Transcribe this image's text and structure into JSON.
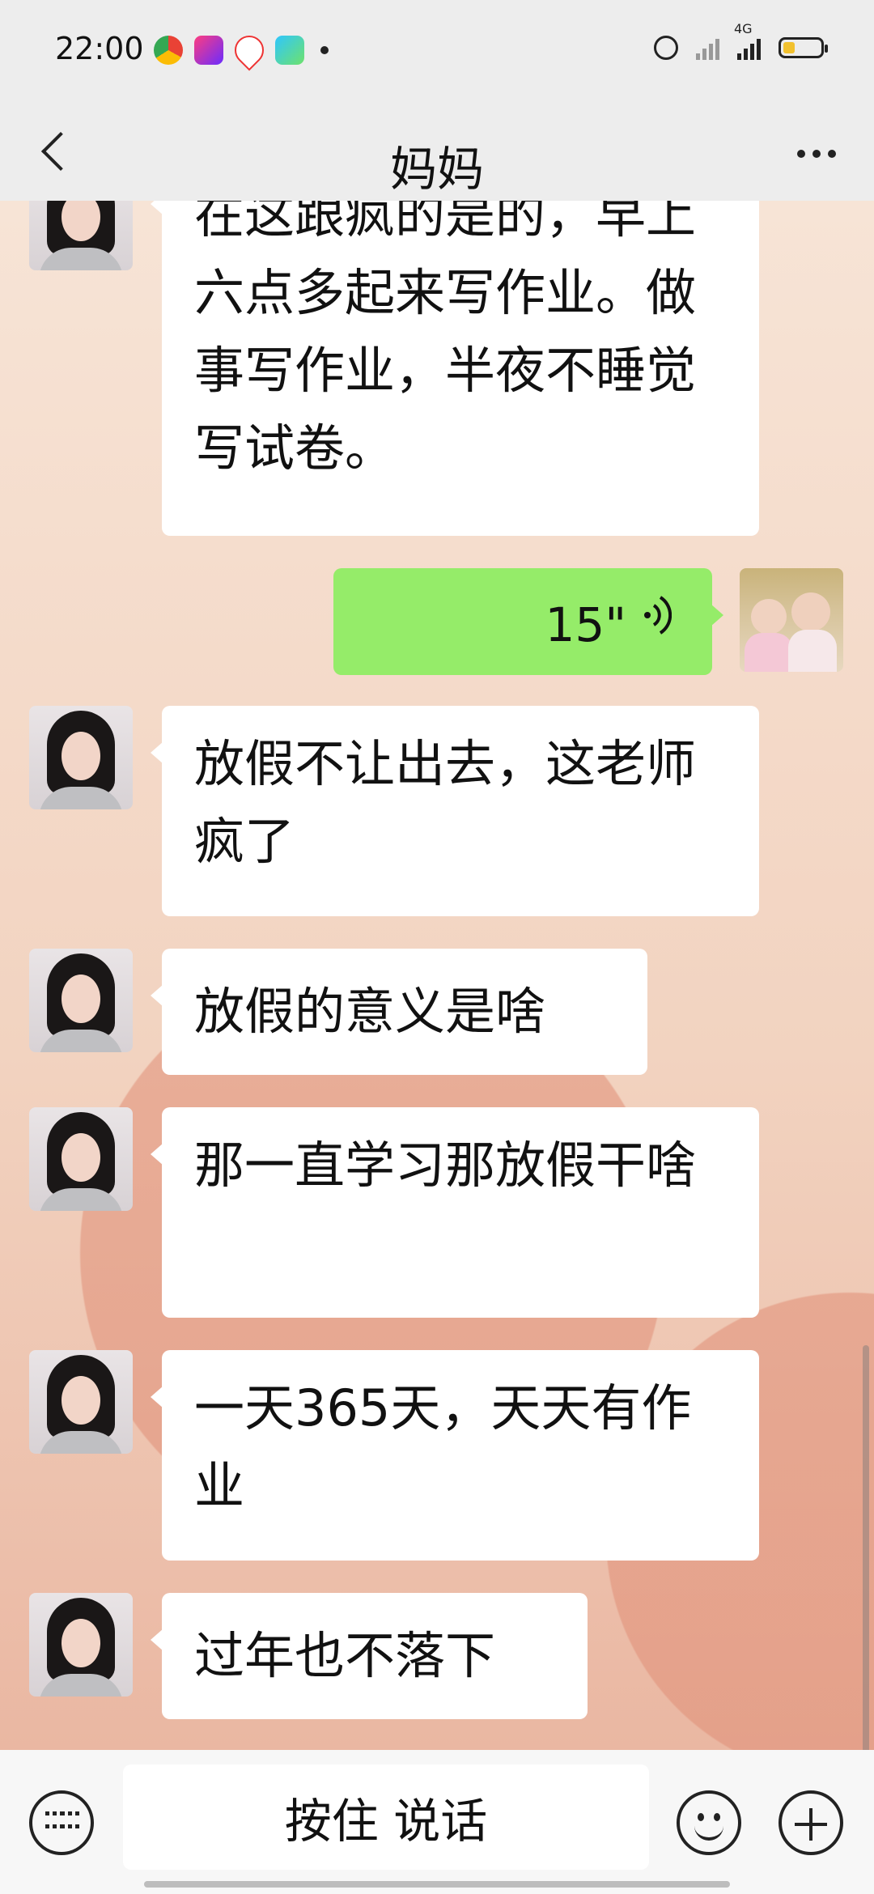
{
  "status_bar": {
    "time": "22:00",
    "network": "4G",
    "app_icons": [
      "chrome-like-app-icon",
      "video-app-icon",
      "map-pin-app-icon",
      "tencent-video-icon"
    ],
    "battery_color": "#f2c12e"
  },
  "header": {
    "title": "妈妈",
    "back_icon": "chevron-left-icon",
    "more_icon": "ellipsis-icon"
  },
  "messages": [
    {
      "side": "left",
      "text": "在这跟疯的是的，早上六点多起来写作业。做事写作业，半夜不睡觉写试卷。"
    },
    {
      "side": "right",
      "type": "voice",
      "duration": "15\""
    },
    {
      "side": "left",
      "text": "放假不让出去，这老师疯了"
    },
    {
      "side": "left",
      "text": "放假的意义是啥"
    },
    {
      "side": "left",
      "text": "那一直学习那放假干啥"
    },
    {
      "side": "left",
      "text": "一天365天，天天有作业"
    },
    {
      "side": "left",
      "text": "过年也不落下"
    }
  ],
  "bottom_bar": {
    "hold_to_talk": "按住 说话",
    "keyboard_icon": "keyboard-icon",
    "emoji_icon": "emoji-icon",
    "plus_icon": "plus-icon"
  },
  "colors": {
    "header_bg": "#ededed",
    "my_bubble": "#95ec69",
    "their_bubble": "#ffffff"
  }
}
